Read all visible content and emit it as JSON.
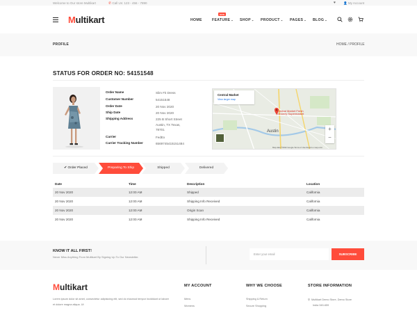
{
  "topbar": {
    "welcome": "Welcome to Our store Multikart",
    "call": "Call Us: 123 - 456 - 7890",
    "account": "My Account"
  },
  "header": {
    "logo_m": "M",
    "logo_rest": "ultikart",
    "nav": [
      {
        "label": "HOME",
        "chevron": false
      },
      {
        "label": "FEATURE",
        "chevron": true,
        "badge": "new"
      },
      {
        "label": "SHOP",
        "chevron": true
      },
      {
        "label": "PRODUCT",
        "chevron": true
      },
      {
        "label": "PAGES",
        "chevron": true
      },
      {
        "label": "BLOG",
        "chevron": true
      }
    ],
    "icons": [
      "search-icon",
      "settings-icon",
      "cart-icon"
    ]
  },
  "breadcrumb": {
    "page": "PROFILE",
    "trail": "HOME  /  PROFILE"
  },
  "order": {
    "status_title": "STATUS FOR ORDER NO: 54151548",
    "details": [
      {
        "label": "Order Name",
        "value": "Slim Fit Dress"
      },
      {
        "label": "Customer Number",
        "value": "54151548"
      },
      {
        "label": "Order Date",
        "value": "20 Nov 2020"
      },
      {
        "label": "Ship Date",
        "value": "20 Nov 2020"
      },
      {
        "label": "Shipping Address",
        "value": "225 B Short Street Austin, TX Texas, 78701"
      },
      {
        "label": "Carrier",
        "value": "FedEx"
      },
      {
        "label": "Carrier Tracking Number",
        "value": "6569745415151484"
      }
    ]
  },
  "map": {
    "place": "Central Market",
    "larger_link": "View larger map",
    "marker_label": "Central Market Fresh Grocery Supermarket",
    "city": "Austin",
    "attribution": "Map data ©2022 Google   Terms of Use   Report a map error"
  },
  "steps": [
    {
      "label": "Order Placed",
      "state": "done",
      "check": "✔"
    },
    {
      "label": "Preparing To Ship",
      "state": "active"
    },
    {
      "label": "Shipped",
      "state": "todo"
    },
    {
      "label": "Delivered",
      "state": "todo"
    }
  ],
  "tracking": {
    "headers": [
      "Date",
      "Time",
      "Description",
      "Location"
    ],
    "rows": [
      [
        "20 Nov 2020",
        "12:00 AM",
        "Shipped",
        "California"
      ],
      [
        "20 Nov 2020",
        "12:00 AM",
        "Shipping Info Received",
        "California"
      ],
      [
        "20 Nov 2020",
        "12:00 AM",
        "Origin Scan",
        "California"
      ],
      [
        "20 Nov 2020",
        "12:00 AM",
        "Shipping Info Received",
        "California"
      ]
    ]
  },
  "newsletter": {
    "title": "KNOW IT ALL FIRST!",
    "subtitle": "Never Miss Anything From Multikart By Signing Up To Our Newsletter.",
    "placeholder": "Enter your email",
    "button": "SUBSCRIBE"
  },
  "footer": {
    "desc": "Lorem ipsum dolor sit amet, consectetur adipisicing elit, sed do eiusmod tempor incididunt ut labore et dolore magna aliqua. Ut",
    "col1": {
      "title": "MY ACCOUNT",
      "links": [
        "Mens",
        "Womens"
      ]
    },
    "col2": {
      "title": "WHY WE CHOOSE",
      "links": [
        "Shipping & Return",
        "Secure Shopping"
      ]
    },
    "col3": {
      "title": "STORE INFORMATION",
      "lines": [
        "Multikart Demo Store, Demo Store",
        "India 345-659"
      ]
    }
  },
  "colors": {
    "accent": "#ff4c3b",
    "dark": "#222222",
    "light_bg": "#f8f8f8"
  }
}
